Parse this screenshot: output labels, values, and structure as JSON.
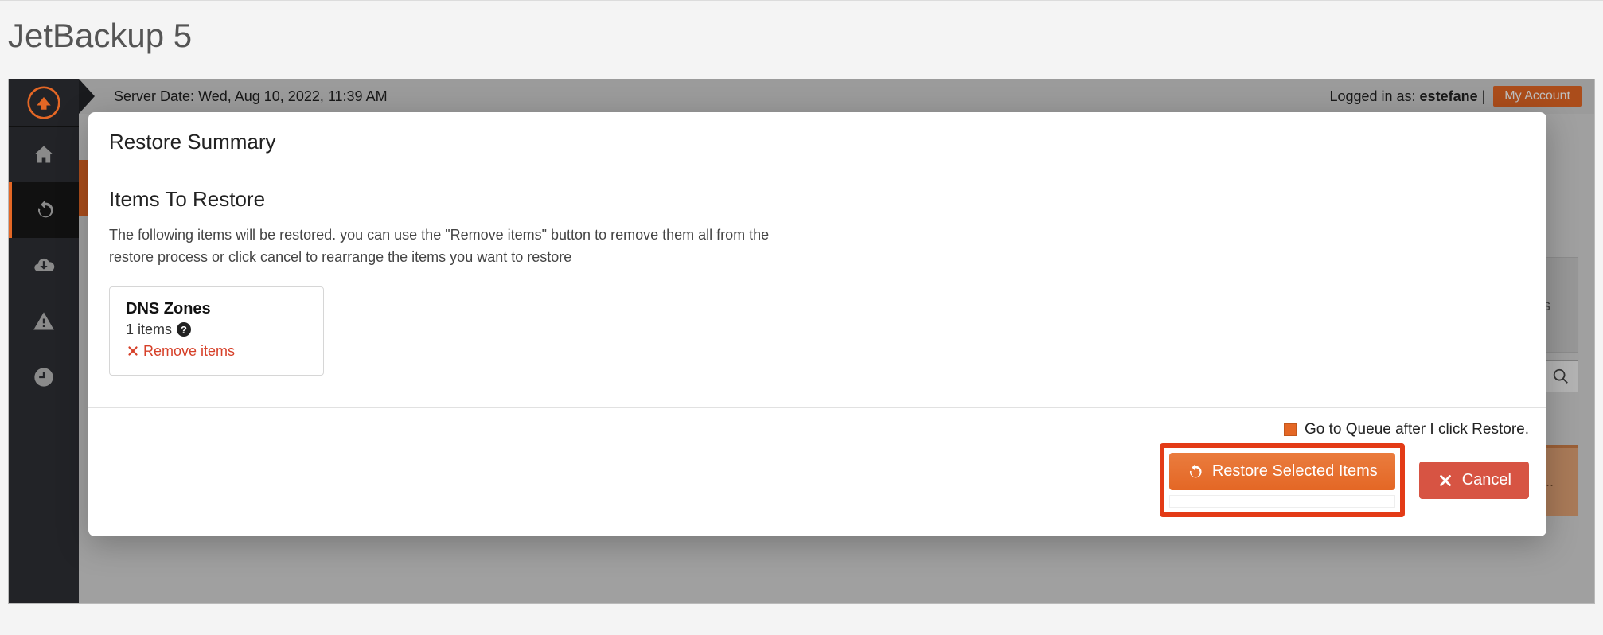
{
  "page": {
    "title": "JetBackup 5"
  },
  "topbar": {
    "server_date_label": "Server Date:",
    "server_date_value": "Wed, Aug 10, 2022, 11:39 AM",
    "logged_in_label": "Logged in as:",
    "username": "estefane",
    "my_account_label": "My Account"
  },
  "sidebar": {
    "items": [
      {
        "name": "home"
      },
      {
        "name": "restore",
        "active": true
      },
      {
        "name": "download"
      },
      {
        "name": "alerts"
      },
      {
        "name": "schedule"
      }
    ]
  },
  "background": {
    "footer_text_suffix": "s..."
  },
  "modal": {
    "title": "Restore Summary",
    "section_title": "Items To Restore",
    "description": "The following items will be restored. you can use the \"Remove items\" button to remove them all from the restore process or click cancel to rearrange the items you want to restore",
    "card": {
      "title": "DNS Zones",
      "count_text": "1 items",
      "remove_label": "Remove items"
    },
    "footer": {
      "queue_label": "Go to Queue after I click Restore.",
      "restore_button": "Restore Selected Items",
      "cancel_button": "Cancel"
    }
  },
  "colors": {
    "accent": "#e46725",
    "danger": "#d64029",
    "highlight": "#e33b16"
  }
}
